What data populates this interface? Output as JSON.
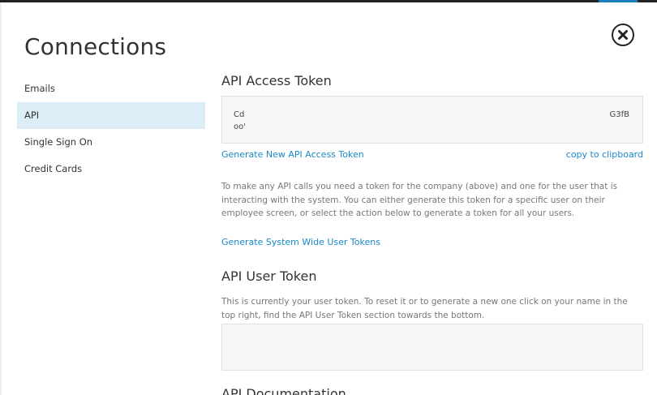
{
  "header": {
    "title": "Connections"
  },
  "sidebar": {
    "items": [
      {
        "label": "Emails"
      },
      {
        "label": "API"
      },
      {
        "label": "Single Sign On"
      },
      {
        "label": "Credit Cards"
      }
    ]
  },
  "api_access_token": {
    "heading": "API Access Token",
    "token_line1_start": "Cd",
    "token_line1_end": "G3fB",
    "token_line2_start": "oo'",
    "generate_link": "Generate New API Access Token",
    "copy_link": "copy to clipboard",
    "description": "To make any API calls you need a token for the company (above) and one for the user that is interacting with the system. You can either generate this token for a specific user on their employee screen, or select the action below to generate a token for all your users.",
    "system_wide_link": "Generate System Wide User Tokens"
  },
  "api_user_token": {
    "heading": "API User Token",
    "description": "This is currently your user token. To reset it or to generate a new one click on your name in the top right, find the API User Token section towards the bottom."
  },
  "api_documentation": {
    "heading": "API Documentation"
  },
  "icons": {
    "close": "close-icon"
  }
}
